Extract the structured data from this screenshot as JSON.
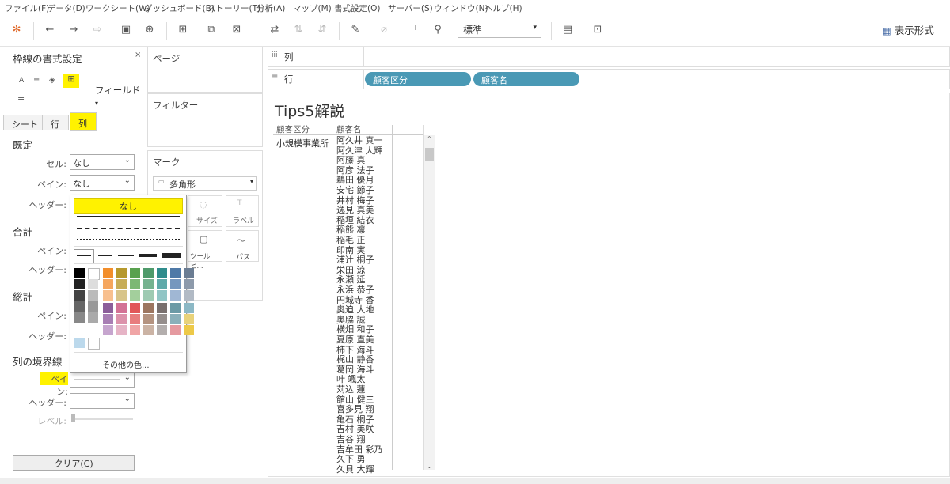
{
  "menu": [
    "ファイル(F)",
    "データ(D)",
    "ワークシート(W)",
    "ダッシュボード(B)",
    "ストーリー(T)",
    "分析(A)",
    "マップ(M)",
    "書式設定(O)",
    "サーバー(S)",
    "ウィンドウ(N)",
    "ヘルプ(H)"
  ],
  "toolbar": {
    "fit_value": "標準",
    "show_me": "表示形式"
  },
  "format_pane": {
    "title": "枠線の書式設定",
    "close": "×",
    "fields_label": "フィールド",
    "tabs": [
      "シート",
      "行",
      "列"
    ],
    "sections": {
      "default": "既定",
      "total": "合計",
      "grand_total": "総計",
      "column_dividers": "列の境界線"
    },
    "labels": {
      "cell": "セル:",
      "pane": "ペイン:",
      "header": "ヘッダー:",
      "level": "レベル:"
    },
    "values": {
      "cell": "なし",
      "pane": "なし"
    },
    "clear_button": "クリア(C)"
  },
  "popup": {
    "none_label": "なし",
    "more_colors": "その他の色..."
  },
  "shelves": {
    "pages": "ページ",
    "filters": "フィルター",
    "marks": "マーク",
    "mark_type": "多角形",
    "mark_buttons": [
      "サイズ",
      "ラベル",
      "ツールヒ...",
      "パス"
    ],
    "columns": "列",
    "rows": "行",
    "row_pills": [
      "顧客区分",
      "顧客名"
    ]
  },
  "sheet": {
    "title": "Tips5解説",
    "headers": [
      "顧客区分",
      "顧客名"
    ],
    "segment": "小規模事業所",
    "names": [
      "阿久井 真一",
      "阿久津 大輝",
      "阿藤 真",
      "阿彦 法子",
      "鵜田 優月",
      "安宅 節子",
      "井村 梅子",
      "逸見 真美",
      "稲垣 結衣",
      "稲熊 凛",
      "稲毛 正",
      "印南 実",
      "浦辻 桐子",
      "栄田 涼",
      "永瀬 延",
      "永浜 恭子",
      "円城寺 香",
      "奥迫 大地",
      "奥脇 誠",
      "横畑 和子",
      "夏原 直美",
      "柿下 海斗",
      "梶山 静香",
      "葛岡 海斗",
      "叶 颯太",
      "苅込 蓮",
      "館山 健三",
      "喜多見 翔",
      "亀石 桐子",
      "吉村 美咲",
      "吉谷 翔",
      "吉牟田 彩乃",
      "久下 勇",
      "久貝 大輝"
    ]
  },
  "colors": {
    "highlight": "#fff200",
    "pill": "#4a99b5"
  }
}
